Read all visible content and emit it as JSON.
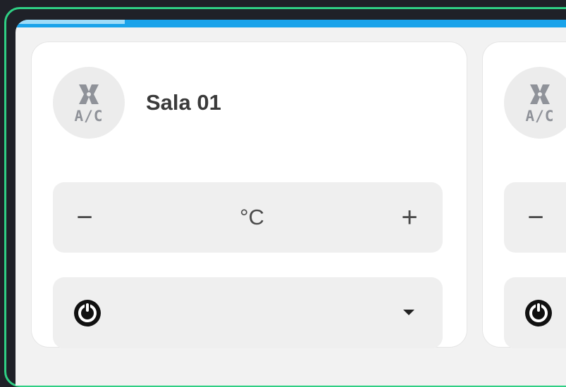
{
  "colors": {
    "frame_border": "#2fcf84",
    "accent_bar": "#1aa3ea",
    "card_background": "#ffffff",
    "control_background": "#efefef"
  },
  "cards": [
    {
      "icon": "fan-ac-icon",
      "icon_label": "A/C",
      "room_name": "Sala 01",
      "temp_decrease": "−",
      "temp_unit": "°C",
      "temp_increase": "+",
      "mode_icon": "power-mode-icon",
      "mode_value": ""
    },
    {
      "icon": "fan-ac-icon",
      "icon_label": "A/C",
      "room_name": "",
      "temp_decrease": "−",
      "temp_unit": "",
      "temp_increase": "",
      "mode_icon": "power-mode-icon",
      "mode_value": ""
    }
  ]
}
